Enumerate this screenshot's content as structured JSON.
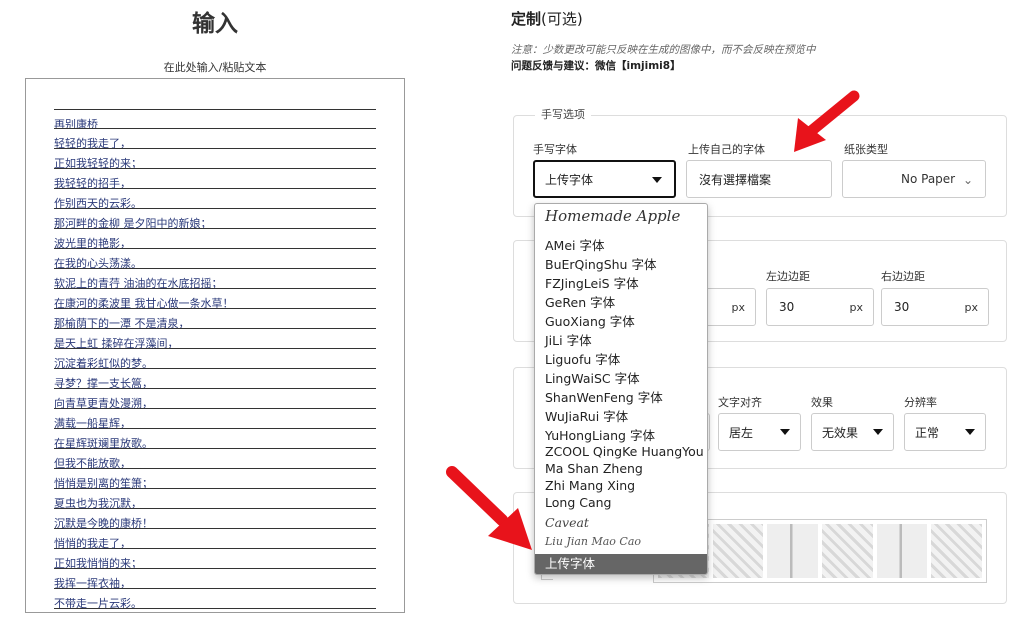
{
  "input": {
    "title": "输入",
    "subtitle": "在此处输入/粘贴文本",
    "lines": [
      "再别康桥",
      "轻轻的我走了，",
      "正如我轻轻的来；",
      "我轻轻的招手，",
      "作别西天的云彩。",
      "那河畔的金柳 是夕阳中的新娘；",
      "波光里的艳影，",
      "在我的心头荡漾。",
      "软泥上的青荇 油油的在水底招摇；",
      "在康河的柔波里 我甘心做一条水草！",
      "那榆荫下的一潭 不是清泉，",
      "是天上虹 揉碎在浮藻间，",
      "沉淀着彩虹似的梦。",
      "寻梦？撑一支长篙，",
      "向青草更青处漫溯，",
      "满载一船星辉，",
      "在星辉斑斓里放歌。",
      "但我不能放歌，",
      "悄悄是别离的笙箫；",
      "夏虫也为我沉默，",
      "沉默是今晚的康桥！",
      "悄悄的我走了，",
      "正如我悄悄的来；",
      "我挥一挥衣袖，",
      "不带走一片云彩。"
    ]
  },
  "custom": {
    "title": "定制",
    "title_suffix": "(可选)",
    "note": "注意：少数更改可能只反映在生成的图像中，而不会反映在预览中",
    "feedback": "问题反馈与建议：微信【imjimi8】"
  },
  "handwriting": {
    "legend": "手写选项",
    "font_label": "手写字体",
    "font_value": "上传字体",
    "upload_label": "上传自己的字体",
    "upload_value": "沒有選擇檔案",
    "paper_label": "纸张类型",
    "paper_value": "No Paper"
  },
  "margins": {
    "unit": "px",
    "left_label": "左边边距",
    "left_value": "30",
    "right_label": "右边边距",
    "right_value": "30"
  },
  "text_opts": {
    "align_label": "文字对齐",
    "align_value": "居左",
    "effect_label": "效果",
    "effect_value": "无效果",
    "resolution_label": "分辨率",
    "resolution_value": "正常"
  },
  "dropdown": {
    "options": [
      "Homemade Apple",
      "AMei 字体",
      "BuErQingShu 字体",
      "FZJingLeiS 字体",
      "GeRen 字体",
      "GuoXiang 字体",
      "JiLi 字体",
      "Liguofu 字体",
      "LingWaiSC 字体",
      "ShanWenFeng 字体",
      "WuJiaRui 字体",
      "YuHongLiang 字体",
      "ZCOOL QingKe HuangYou",
      "Ma Shan Zheng",
      "Zhi Mang Xing",
      "Long Cang",
      "Caveat",
      "Liu Jian Mao Cao"
    ],
    "selected": "上传字体"
  },
  "colors": {
    "arrow": "#e8131b",
    "selected_bg": "#666666"
  }
}
